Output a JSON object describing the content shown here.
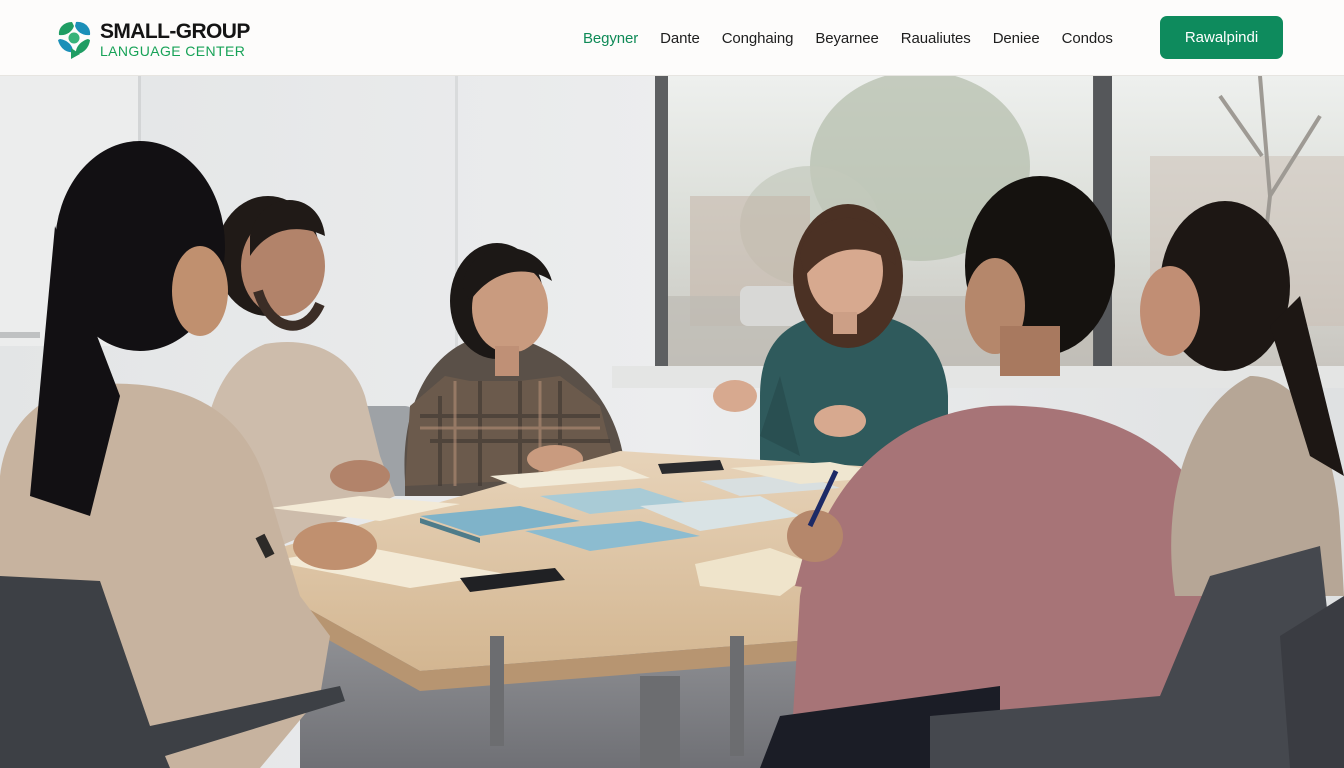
{
  "brand": {
    "name_line1": "SMALL-GROUP",
    "name_line2": "LANGUAGE CENTER",
    "accent_color": "#17a257",
    "button_color": "#0e8b5d"
  },
  "nav": {
    "items": [
      {
        "label": "Begyner",
        "active": true
      },
      {
        "label": "Dante",
        "active": false
      },
      {
        "label": "Conghaing",
        "active": false
      },
      {
        "label": "Beyarnee",
        "active": false
      },
      {
        "label": "Raualiutes",
        "active": false
      },
      {
        "label": "Deniee",
        "active": false
      },
      {
        "label": "Condos",
        "active": false
      }
    ],
    "cta_label": "Rawalpindi"
  },
  "icons": {
    "logo": "leaf-cluster-logo-icon"
  }
}
